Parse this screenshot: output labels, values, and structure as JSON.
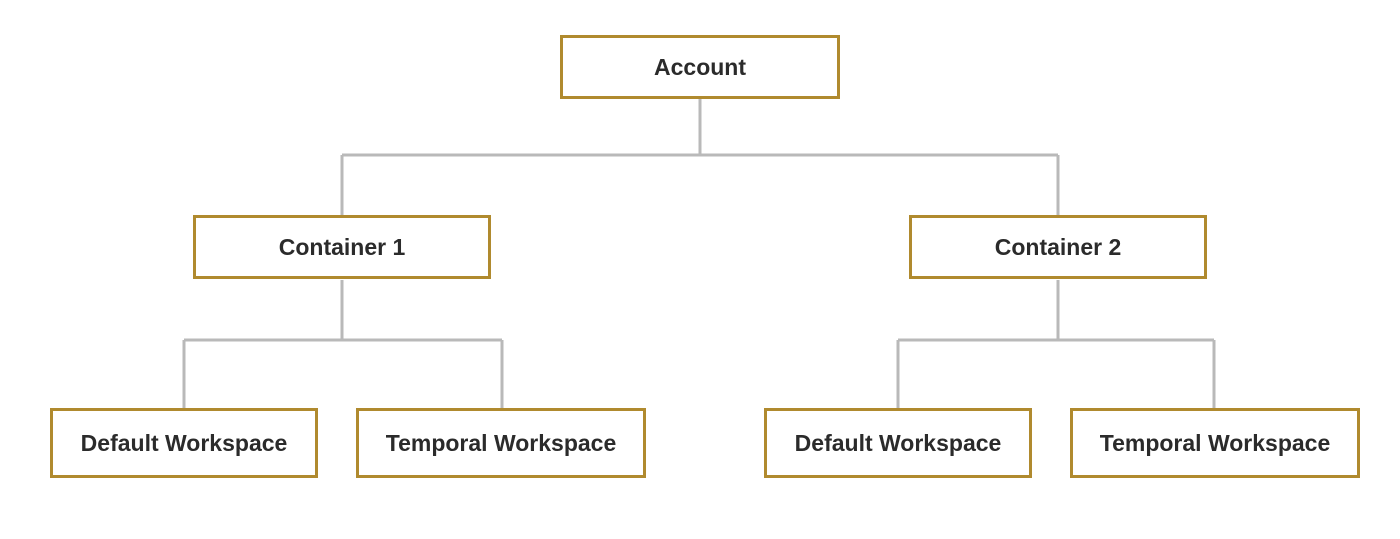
{
  "colors": {
    "node_border": "#b08a2e",
    "connector": "#b9b9b9",
    "text": "#2b2b2b",
    "background": "#ffffff"
  },
  "diagram": {
    "root": {
      "label": "Account"
    },
    "children": [
      {
        "label": "Container 1",
        "children": [
          {
            "label": "Default Workspace"
          },
          {
            "label": "Temporal Workspace"
          }
        ]
      },
      {
        "label": "Container 2",
        "children": [
          {
            "label": "Default Workspace"
          },
          {
            "label": "Temporal Workspace"
          }
        ]
      }
    ]
  }
}
